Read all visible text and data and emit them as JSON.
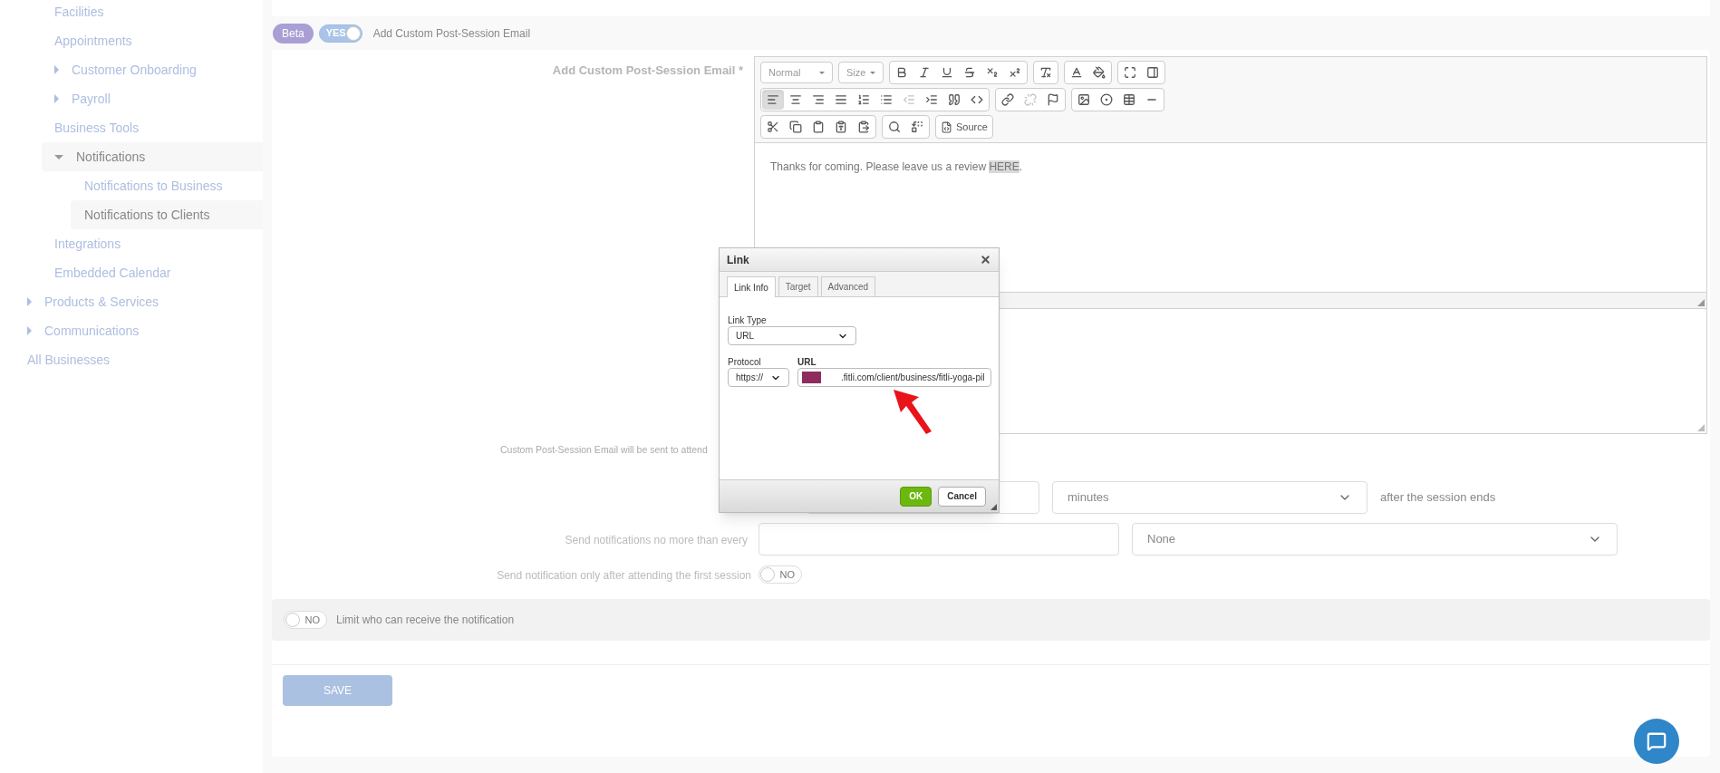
{
  "sidebar": {
    "section_items": [
      {
        "label": "Facilities",
        "kind": "link",
        "selected": false
      },
      {
        "label": "Appointments",
        "kind": "link",
        "selected": false
      },
      {
        "label": "Customer Onboarding",
        "kind": "group",
        "selected": false,
        "expanded": false
      },
      {
        "label": "Payroll",
        "kind": "group",
        "selected": false,
        "expanded": false
      },
      {
        "label": "Business Tools",
        "kind": "link",
        "selected": false
      },
      {
        "label": "Notifications",
        "kind": "group",
        "selected": true,
        "expanded": true,
        "children": [
          {
            "label": "Notifications to Business",
            "selected": false
          },
          {
            "label": "Notifications to Clients",
            "selected": true
          }
        ]
      },
      {
        "label": "Integrations",
        "kind": "link",
        "selected": false
      },
      {
        "label": "Embedded Calendar",
        "kind": "link",
        "selected": false
      }
    ],
    "items": [
      {
        "label": "Products & Services",
        "kind": "group",
        "selected": false,
        "expanded": false
      },
      {
        "label": "Communications",
        "kind": "group",
        "selected": false,
        "expanded": false
      },
      {
        "label": "All Businesses",
        "kind": "link",
        "selected": false
      }
    ]
  },
  "beta_badge": "Beta",
  "custom_email_toggle": {
    "on": true,
    "text": "YES",
    "label": "Add Custom Post-Session Email"
  },
  "editor": {
    "label": "Add Custom Post-Session Email *",
    "format": "Normal",
    "size": "Size",
    "source_label": "Source",
    "toolbar": [
      [
        [
          {
            "kind": "bold",
            "selected": false,
            "disabled": false
          },
          {
            "kind": "italic",
            "selected": false,
            "disabled": false
          },
          {
            "kind": "underline",
            "selected": false,
            "disabled": false
          },
          {
            "kind": "strike",
            "selected": false,
            "disabled": false
          },
          {
            "kind": "subscript",
            "selected": false,
            "disabled": false
          },
          {
            "kind": "superscript",
            "selected": false,
            "disabled": false
          }
        ],
        [
          {
            "kind": "remove_format",
            "selected": false,
            "disabled": false
          }
        ],
        [
          {
            "kind": "text_color",
            "selected": false,
            "disabled": false
          },
          {
            "kind": "bg_color",
            "selected": false,
            "disabled": false
          }
        ],
        [
          {
            "kind": "maximize",
            "selected": false,
            "disabled": false
          },
          {
            "kind": "show_blocks",
            "selected": false,
            "disabled": false
          }
        ]
      ],
      [
        [
          {
            "kind": "align_left",
            "selected": true,
            "disabled": false
          },
          {
            "kind": "align_center",
            "selected": false,
            "disabled": false
          },
          {
            "kind": "align_right",
            "selected": false,
            "disabled": false
          },
          {
            "kind": "justify",
            "selected": false,
            "disabled": false
          },
          {
            "kind": "numbered_list",
            "selected": false,
            "disabled": false
          },
          {
            "kind": "bulleted_list",
            "selected": false,
            "disabled": false
          },
          {
            "kind": "outdent",
            "selected": false,
            "disabled": true
          },
          {
            "kind": "indent",
            "selected": false,
            "disabled": false
          },
          {
            "kind": "blockquote",
            "selected": false,
            "disabled": false
          },
          {
            "kind": "div",
            "selected": false,
            "disabled": false
          }
        ],
        [
          {
            "kind": "link",
            "selected": false,
            "disabled": false
          },
          {
            "kind": "unlink",
            "selected": false,
            "disabled": true
          },
          {
            "kind": "anchor",
            "selected": false,
            "disabled": false
          }
        ],
        [
          {
            "kind": "image",
            "selected": false,
            "disabled": false
          },
          {
            "kind": "flash",
            "selected": false,
            "disabled": false
          },
          {
            "kind": "table",
            "selected": false,
            "disabled": false
          },
          {
            "kind": "horizontal_rule",
            "selected": false,
            "disabled": false
          }
        ]
      ],
      [
        [
          {
            "kind": "cut",
            "selected": false,
            "disabled": false
          },
          {
            "kind": "copy",
            "selected": false,
            "disabled": false
          },
          {
            "kind": "paste",
            "selected": false,
            "disabled": false
          },
          {
            "kind": "paste_text",
            "selected": false,
            "disabled": false
          },
          {
            "kind": "paste_word",
            "selected": false,
            "disabled": false
          }
        ],
        [
          {
            "kind": "find",
            "selected": false,
            "disabled": false
          },
          {
            "kind": "replace",
            "selected": false,
            "disabled": false
          }
        ],
        [
          {
            "kind": "source",
            "selected": false,
            "disabled": false
          }
        ]
      ]
    ],
    "content": {
      "before": "Thanks for coming. Please leave us a review ",
      "link": "HERE",
      "after": "."
    }
  },
  "sent_note": "Custom Post-Session Email will be sent to attend",
  "send_after": {
    "unit": "minutes",
    "suffix": "after the session ends"
  },
  "frequency": {
    "label": "Send notifications no more than every",
    "unit": "None"
  },
  "first_session_only": {
    "label": "Send notification only after attending the first session",
    "on": false,
    "text": "NO"
  },
  "limit_recipients": {
    "label": "Limit who can receive the notification",
    "on": false,
    "text": "NO"
  },
  "save_button": "SAVE",
  "dialog": {
    "title": "Link",
    "tabs": [
      {
        "label": "Link Info",
        "selected": true
      },
      {
        "label": "Target",
        "selected": false
      },
      {
        "label": "Advanced",
        "selected": false
      }
    ],
    "link_type_label": "Link Type",
    "link_type": "URL",
    "protocol_label": "Protocol",
    "protocol": "https://",
    "url_label": "URL",
    "url": ".fitli.com/client/business/fitli-yoga-pil",
    "buttons": [
      {
        "label": "OK",
        "kind": "primary"
      },
      {
        "label": "Cancel",
        "kind": "secondary"
      }
    ]
  }
}
